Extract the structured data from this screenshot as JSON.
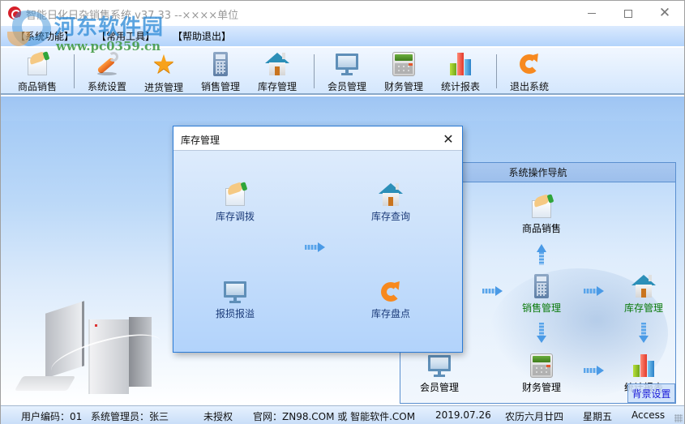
{
  "window": {
    "title": "智能日化日杂销售系统 v37.33 --××××单位",
    "controls": {
      "minimize": "—",
      "maximize": "☐",
      "close": "✕"
    }
  },
  "watermark": {
    "title": "河东软件园",
    "url": "www.pc0359.cn"
  },
  "menubar": {
    "items": [
      {
        "label": "【系统功能】"
      },
      {
        "label": "【常用工具】"
      },
      {
        "label": "【帮助退出】"
      }
    ]
  },
  "toolbar": {
    "items": [
      {
        "label": "商品销售",
        "icon": "hand-paper-icon"
      },
      {
        "label": "系统设置",
        "icon": "wrench-icon"
      },
      {
        "label": "进货管理",
        "icon": "star-icon"
      },
      {
        "label": "销售管理",
        "icon": "calculator-icon"
      },
      {
        "label": "库存管理",
        "icon": "house-icon"
      },
      {
        "label": "会员管理",
        "icon": "monitor-icon"
      },
      {
        "label": "财务管理",
        "icon": "finance-calculator-icon"
      },
      {
        "label": "统计报表",
        "icon": "bar-chart-icon"
      },
      {
        "label": "退出系统",
        "icon": "exit-refresh-icon"
      }
    ]
  },
  "nav_panel": {
    "header": "系统操作导航",
    "nodes": {
      "sales": "商品销售",
      "sales_mgmt": "销售管理",
      "inventory_mgmt": "库存管理",
      "member_mgmt": "会员管理",
      "finance_mgmt": "财务管理",
      "reports": "统计报表"
    },
    "background_settings": "背景设置"
  },
  "dialog": {
    "title": "库存管理",
    "close": "✕",
    "items": {
      "transfer": "库存调拨",
      "query": "库存查询",
      "loss": "报损报溢",
      "stocktake": "库存盘点"
    }
  },
  "statusbar": {
    "user_code": "用户编码：01",
    "operator": "系统管理员：张三",
    "license": "未授权",
    "website": "官网：ZN98.COM 或 智能软件.COM",
    "date": "2019.07.26",
    "lunar_date": "农历六月廿四",
    "weekday": "星期五",
    "database": "Access"
  }
}
